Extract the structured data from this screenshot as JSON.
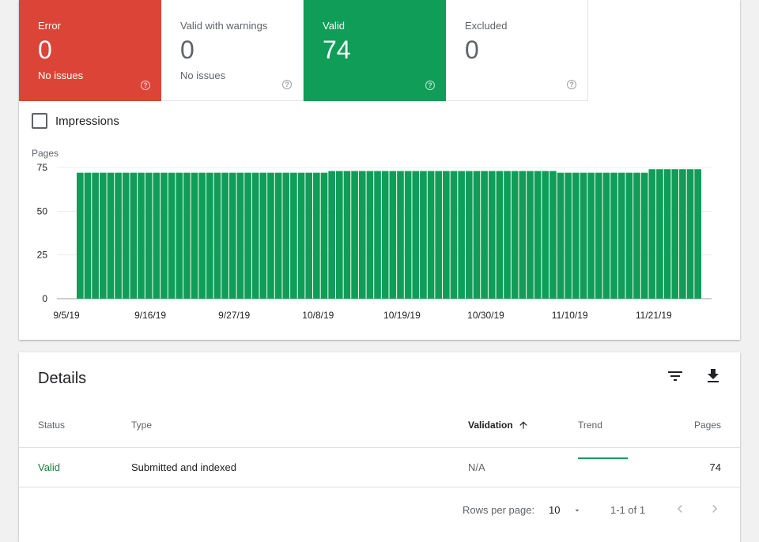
{
  "tiles": [
    {
      "label": "Error",
      "value": "0",
      "sub": "No issues"
    },
    {
      "label": "Valid with warnings",
      "value": "0",
      "sub": "No issues"
    },
    {
      "label": "Valid",
      "value": "74",
      "sub": ""
    },
    {
      "label": "Excluded",
      "value": "0",
      "sub": ""
    }
  ],
  "colors": {
    "error": "#db4437",
    "valid": "#0f9d58"
  },
  "impressions_label": "Impressions",
  "chart_data": {
    "type": "bar",
    "ylabel": "Pages",
    "ylim": [
      0,
      75
    ],
    "yticks": [
      "0",
      "25",
      "50",
      "75"
    ],
    "xticks": [
      "9/5/19",
      "9/16/19",
      "9/27/19",
      "10/8/19",
      "10/19/19",
      "10/30/19",
      "11/10/19",
      "11/21/19"
    ],
    "series": [
      {
        "values": [
          72,
          72,
          72,
          72,
          72,
          72,
          72,
          72,
          72,
          72,
          72,
          72,
          72,
          72,
          72,
          72,
          72,
          72,
          72,
          72,
          72,
          72,
          72,
          72,
          72,
          72,
          72,
          72,
          72,
          72,
          72,
          72,
          72,
          73,
          73,
          73,
          73,
          73,
          73,
          73,
          73,
          73,
          73,
          73,
          73,
          73,
          73,
          73,
          73,
          73,
          73,
          73,
          73,
          73,
          73,
          73,
          73,
          73,
          73,
          73,
          73,
          73,
          73,
          72,
          72,
          72,
          72,
          72,
          72,
          72,
          72,
          72,
          72,
          72,
          72,
          74,
          74,
          74,
          74,
          74,
          74,
          74
        ]
      }
    ]
  },
  "details": {
    "title": "Details",
    "filter_icon": "filter-icon",
    "download_icon": "download-icon",
    "columns": {
      "status": "Status",
      "type": "Type",
      "validation": "Validation",
      "trend": "Trend",
      "pages": "Pages"
    },
    "rows": [
      {
        "status": "Valid",
        "type": "Submitted and indexed",
        "validation": "N/A",
        "pages": "74"
      }
    ],
    "pagination": {
      "rows_per_page_label": "Rows per page:",
      "rows_per_page": "10",
      "range": "1-1 of 1"
    }
  }
}
